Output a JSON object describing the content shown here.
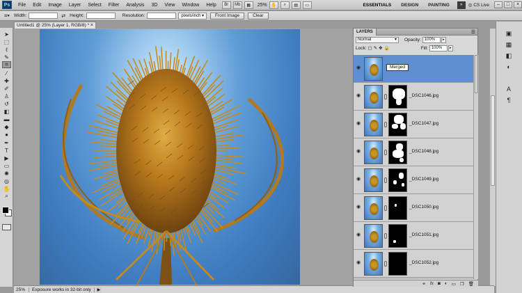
{
  "menubar": {
    "logo": "Ps",
    "items": [
      "File",
      "Edit",
      "Image",
      "Layer",
      "Select",
      "Filter",
      "Analysis",
      "3D",
      "View",
      "Window",
      "Help"
    ],
    "zoom": "25%",
    "workspaces": [
      "ESSENTIALS",
      "DESIGN",
      "PAINTING"
    ],
    "more": "»",
    "cslive": "CS Live",
    "window_buttons": [
      "–",
      "□",
      "×"
    ]
  },
  "options": {
    "width_label": "Width:",
    "width_value": "",
    "height_label": "Height:",
    "height_value": "",
    "resolution_label": "Resolution:",
    "resolution_value": "",
    "unit": "pixels/inch",
    "front_image": "Front Image",
    "clear": "Clear"
  },
  "document": {
    "tab_title": "Untitled1 @ 25% (Layer 1, RGB/8) *",
    "close": "×"
  },
  "status": {
    "zoom": "25%",
    "message": "Exposure works in 32-bit only"
  },
  "layers": {
    "tab": "LAYERS",
    "blend_mode": "Normal",
    "opacity_label": "Opacity:",
    "opacity": "100%",
    "lock_label": "Lock:",
    "fill_label": "Fill:",
    "fill": "100%",
    "rows": [
      {
        "name": "Merged",
        "selected": true
      },
      {
        "name": "_DSC1046.jpg"
      },
      {
        "name": "_DSC1047.jpg"
      },
      {
        "name": "_DSC1048.jpg"
      },
      {
        "name": "_DSC1049.jpg"
      },
      {
        "name": "_DSC1050.jpg"
      },
      {
        "name": "_DSC1051.jpg"
      },
      {
        "name": "_DSC1052.jpg"
      }
    ],
    "bottom_icons": [
      "link-icon",
      "fx-icon",
      "mask-icon",
      "adjustment-icon",
      "group-icon",
      "new-layer-icon",
      "trash-icon"
    ]
  },
  "colors": {
    "selection": "#5f8fd0",
    "teasel": "#c48a22"
  }
}
